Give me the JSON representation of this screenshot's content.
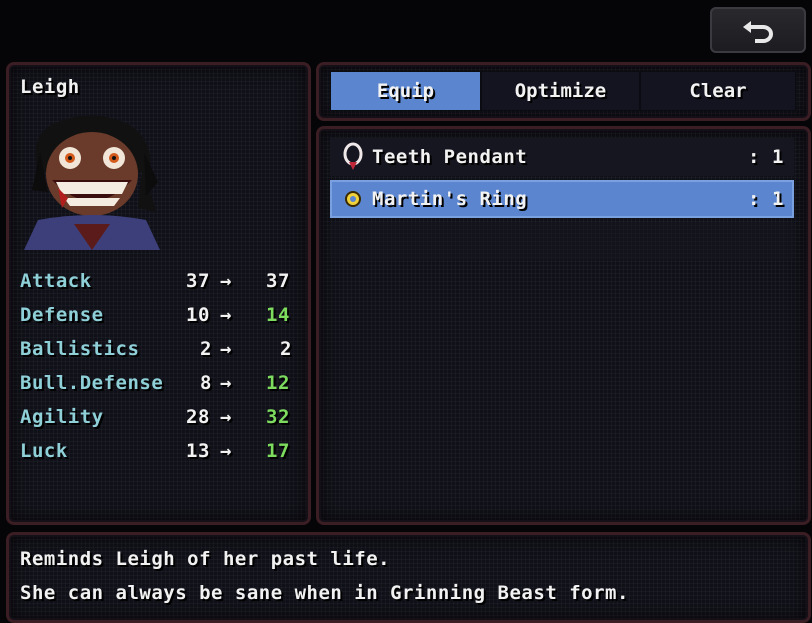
{
  "character": {
    "name": "Leigh"
  },
  "tabs": [
    {
      "label": "Equip",
      "active": true
    },
    {
      "label": "Optimize",
      "active": false
    },
    {
      "label": "Clear",
      "active": false
    }
  ],
  "items": [
    {
      "name": "Teeth Pendant",
      "sep": ":",
      "count": "1",
      "icon": "pendant-icon"
    },
    {
      "name": "Martin's Ring",
      "sep": ":",
      "count": "1",
      "icon": "ring-icon"
    }
  ],
  "stats": [
    {
      "label": "Attack",
      "before": "37",
      "arrow": "→",
      "after": "37",
      "improved": false
    },
    {
      "label": "Defense",
      "before": "10",
      "arrow": "→",
      "after": "14",
      "improved": true
    },
    {
      "label": "Ballistics",
      "before": "2",
      "arrow": "→",
      "after": "2",
      "improved": false
    },
    {
      "label": "Bull.Defense",
      "before": "8",
      "arrow": "→",
      "after": "12",
      "improved": true
    },
    {
      "label": "Agility",
      "before": "28",
      "arrow": "→",
      "after": "32",
      "improved": true
    },
    {
      "label": "Luck",
      "before": "13",
      "arrow": "→",
      "after": "17",
      "improved": true
    }
  ],
  "description": {
    "line1": "Reminds Leigh of her past life.",
    "line2": "She can always be sane when in Grinning Beast form."
  },
  "colors": {
    "accent": "#5b86cf",
    "stat_label": "#8fd0d8",
    "stat_up": "#7ddc5e",
    "border": "#3b1d24"
  },
  "icons": {
    "back": "back-arrow-icon"
  }
}
